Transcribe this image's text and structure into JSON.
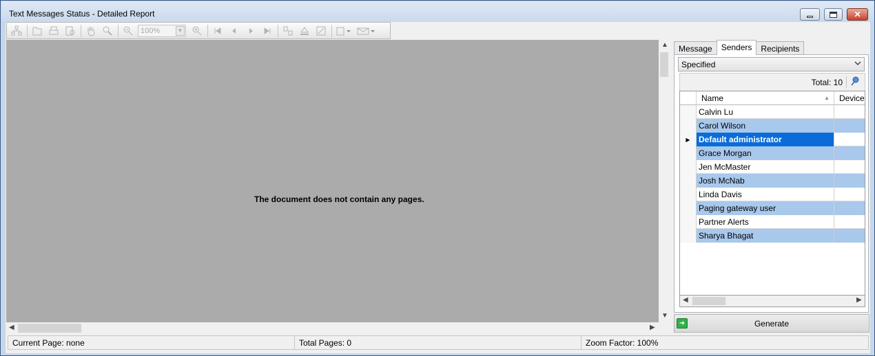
{
  "window": {
    "title": "Text Messages Status - Detailed Report",
    "close_glyph": "✕",
    "maximize_glyph": "▢",
    "minimize_glyph": "▁"
  },
  "toolbar": {
    "zoom_value": "100%",
    "icons": [
      "document-map-icon",
      "open-icon",
      "print-icon",
      "print-preview-icon",
      "hand-tool-icon",
      "magnifier-icon",
      "zoom-out-icon",
      "zoom-in-icon",
      "first-page-icon",
      "previous-page-icon",
      "next-page-icon",
      "last-page-icon",
      "multiple-pages-icon",
      "background-color-icon",
      "watermark-icon",
      "export-icon",
      "email-icon"
    ]
  },
  "document": {
    "message": "The document does not contain any pages."
  },
  "side_panel": {
    "tabs": [
      {
        "label": "Message"
      },
      {
        "label": "Senders"
      },
      {
        "label": "Recipients"
      }
    ],
    "active_tab": "Senders",
    "filter_value": "Specified",
    "total_label": "Total: 10",
    "columns": [
      "Name",
      "Device"
    ],
    "rows": [
      {
        "name": "Calvin Lu"
      },
      {
        "name": "Carol Wilson"
      },
      {
        "name": "Default administrator"
      },
      {
        "name": "Grace Morgan"
      },
      {
        "name": "Jen McMaster"
      },
      {
        "name": "Josh McNab"
      },
      {
        "name": "Linda Davis"
      },
      {
        "name": "Paging gateway user"
      },
      {
        "name": "Partner Alerts"
      },
      {
        "name": "Sharya Bhagat"
      }
    ],
    "selected_row": "Default administrator",
    "generate_label": "Generate"
  },
  "status": {
    "current_page": "Current Page: none",
    "total_pages": "Total Pages: 0",
    "zoom_factor": "Zoom Factor: 100%"
  },
  "colors": {
    "selection": "#0a6cd8",
    "alt_row": "#a8c8ec",
    "doc_background": "#ababab"
  }
}
